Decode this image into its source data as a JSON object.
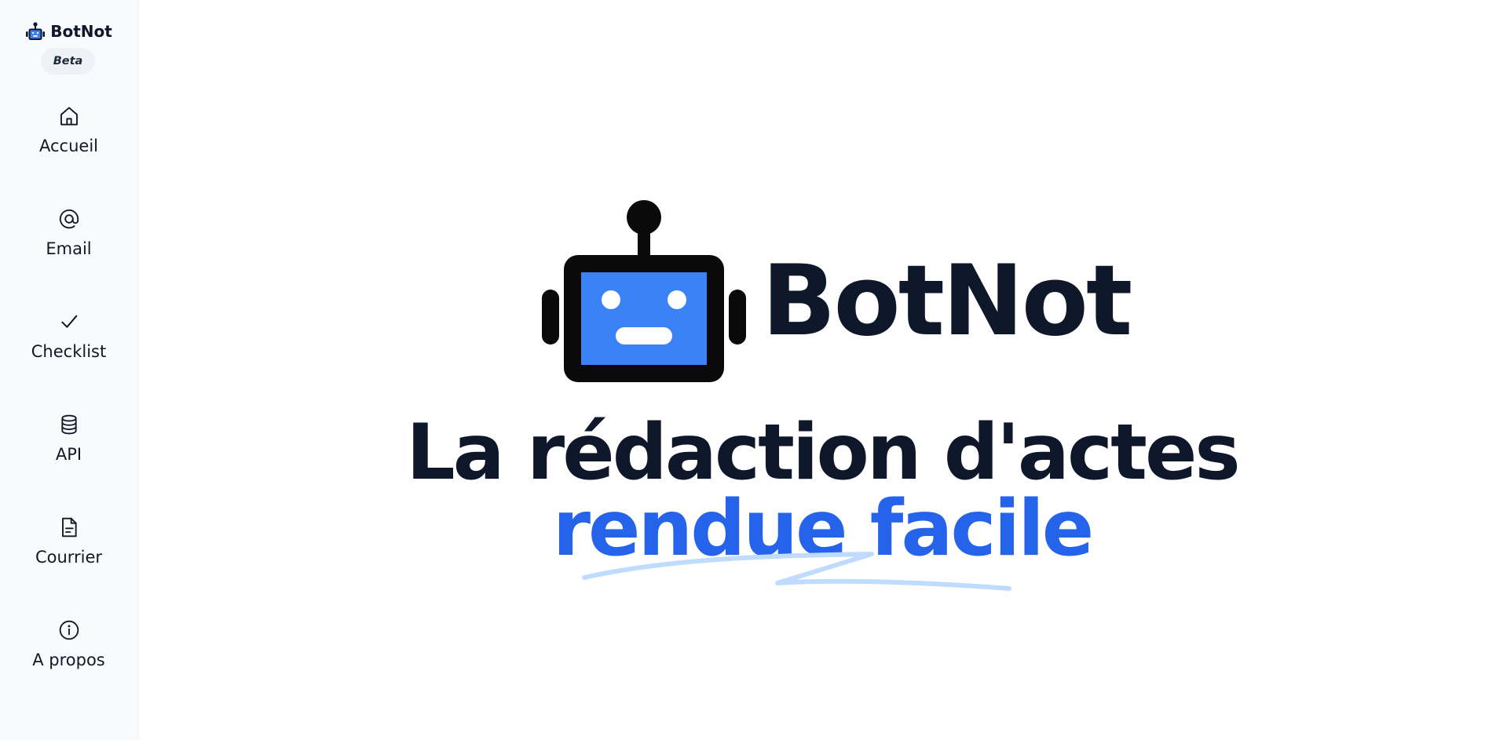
{
  "brand": {
    "name": "BotNot",
    "badge": "Beta"
  },
  "nav": {
    "items": [
      {
        "label": "Accueil",
        "icon": "home-icon"
      },
      {
        "label": "Email",
        "icon": "at-sign-icon"
      },
      {
        "label": "Checklist",
        "icon": "check-icon"
      },
      {
        "label": "API",
        "icon": "database-icon"
      },
      {
        "label": "Courrier",
        "icon": "document-icon"
      },
      {
        "label": "A propos",
        "icon": "info-icon"
      }
    ]
  },
  "hero": {
    "name": "BotNot",
    "title": "La rédaction d'actes",
    "accent": "rendue facile"
  },
  "colors": {
    "text": "#0f172a",
    "accent": "#2563eb",
    "robot_screen": "#3b82f6",
    "underline": "#bfdbfe",
    "sidebar_bg": "#f8fafc"
  }
}
